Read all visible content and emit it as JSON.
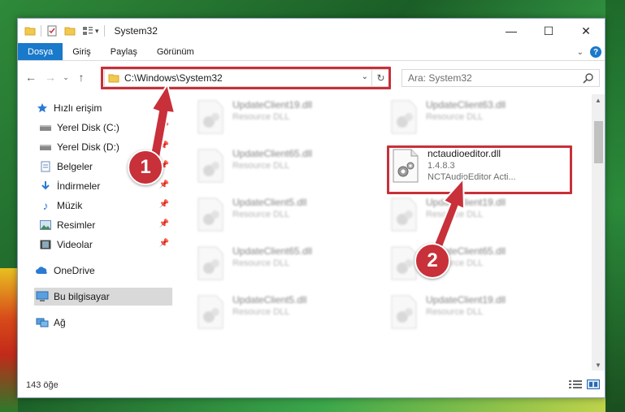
{
  "window": {
    "title": "System32",
    "controls": {
      "minimize": "—",
      "maximize": "☐",
      "close": "✕"
    }
  },
  "ribbon": {
    "tabs": [
      "Dosya",
      "Giriş",
      "Paylaş",
      "Görünüm"
    ]
  },
  "nav": {
    "address": "C:\\Windows\\System32",
    "search_placeholder": "Ara: System32"
  },
  "sidebar": {
    "items": [
      {
        "label": "Hızlı erişim",
        "icon": "star-icon",
        "pinned": false
      },
      {
        "label": "Yerel Disk (C:)",
        "icon": "drive-icon",
        "pinned": true
      },
      {
        "label": "Yerel Disk (D:)",
        "icon": "drive-icon",
        "pinned": true
      },
      {
        "label": "Belgeler",
        "icon": "documents-icon",
        "pinned": true
      },
      {
        "label": "İndirmeler",
        "icon": "downloads-icon",
        "pinned": true
      },
      {
        "label": "Müzik",
        "icon": "music-icon",
        "pinned": true
      },
      {
        "label": "Resimler",
        "icon": "pictures-icon",
        "pinned": true
      },
      {
        "label": "Videolar",
        "icon": "videos-icon",
        "pinned": true
      },
      {
        "label": "OneDrive",
        "icon": "onedrive-icon",
        "pinned": false
      },
      {
        "label": "Bu bilgisayar",
        "icon": "computer-icon",
        "pinned": false
      },
      {
        "label": "Ağ",
        "icon": "network-icon",
        "pinned": false
      }
    ]
  },
  "files": [
    {
      "name": "UpdateClient19.dll",
      "sub": "Resource DLL",
      "blurred": true
    },
    {
      "name": "UpdateClient63.dll",
      "sub": "Resource DLL",
      "blurred": true
    },
    {
      "name": "UpdateClient65.dll",
      "sub": "Resource DLL",
      "blurred": true
    },
    {
      "name": "nctaudioeditor.dll",
      "version": "1.4.8.3",
      "description": "NCTAudioEditor Acti...",
      "blurred": false
    },
    {
      "name": "UpdateClient5.dll",
      "sub": "Resource DLL",
      "blurred": true
    },
    {
      "name": "UpdateClient19.dll",
      "sub": "Resource DLL",
      "blurred": true
    },
    {
      "name": "UpdateClient65.dll",
      "sub": "Resource DLL",
      "blurred": true
    },
    {
      "name": "UpdateClient65.dll",
      "sub": "Resource DLL",
      "blurred": true
    },
    {
      "name": "UpdateClient5.dll",
      "sub": "Resource DLL",
      "blurred": true
    },
    {
      "name": "UpdateClient19.dll",
      "sub": "Resource DLL",
      "blurred": true
    }
  ],
  "status": {
    "item_count": "143 öğe"
  },
  "callouts": [
    "1",
    "2"
  ],
  "colors": {
    "accent": "#1979ca",
    "highlight": "#c8303a"
  }
}
